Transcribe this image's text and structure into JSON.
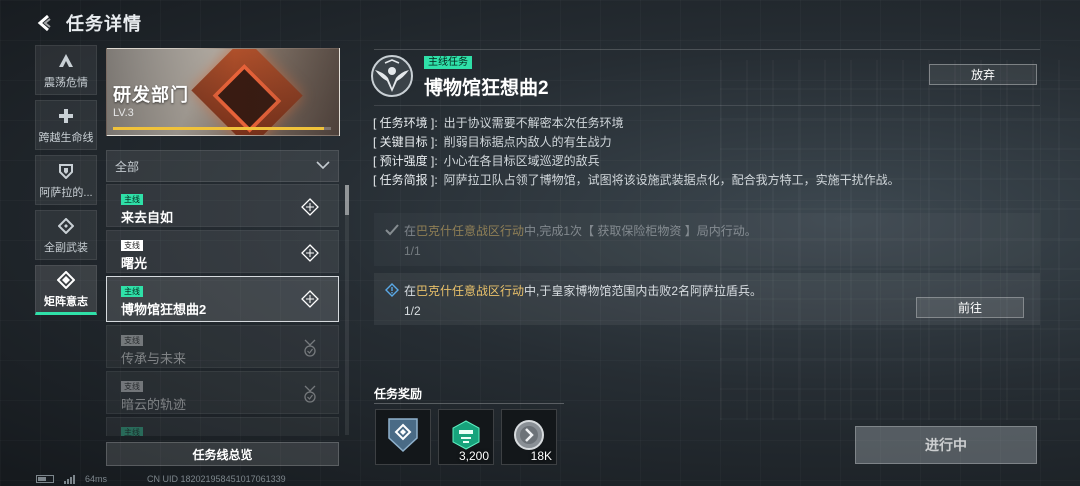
{
  "header": {
    "title": "任务详情"
  },
  "rail": [
    {
      "label": "震荡危情",
      "icon": "triangle-logo-icon"
    },
    {
      "label": "跨越生命线",
      "icon": "plus-icon"
    },
    {
      "label": "阿萨拉的...",
      "icon": "shield-icon"
    },
    {
      "label": "全副武装",
      "icon": "hex-diamond-icon"
    },
    {
      "label": "矩阵意志",
      "icon": "matrix-diamond-icon",
      "active": true
    }
  ],
  "banner": {
    "title": "研发部门",
    "level": "LV.3",
    "progress": 0.97,
    "bar_color": "#f0c23a"
  },
  "filter": {
    "selected": "全部"
  },
  "quests": [
    {
      "tag": "主线",
      "name": "来去自如",
      "tag_type": "main",
      "state": "active"
    },
    {
      "tag": "支线",
      "name": "曙光",
      "tag_type": "side",
      "state": "active"
    },
    {
      "tag": "主线",
      "name": "博物馆狂想曲2",
      "tag_type": "main",
      "state": "selected"
    },
    {
      "tag": "支线",
      "name": "传承与未来",
      "tag_type": "side",
      "state": "done"
    },
    {
      "tag": "支线",
      "name": "暗云的轨迹",
      "tag_type": "side",
      "state": "done"
    },
    {
      "tag": "主线",
      "name": "",
      "tag_type": "main",
      "state": "done"
    }
  ],
  "overview_button": "任务线总览",
  "status": {
    "ping": "64ms",
    "uid": "CN UID 182021958451017061339"
  },
  "detail": {
    "tag": "主线任务",
    "title": "博物馆狂想曲2",
    "abandon": "放弃",
    "info": [
      {
        "key": "[ 任务环境 ]:",
        "value": "出于协议需要不解密本次任务环境"
      },
      {
        "key": "[ 关键目标 ]:",
        "value": "削弱目标据点内敌人的有生战力"
      },
      {
        "key": "[ 预计强度 ]:",
        "value": "小心在各目标区域巡逻的敌兵"
      },
      {
        "key": "[ 任务简报 ]:",
        "value": "阿萨拉卫队占领了博物馆，试图将该设施武装据点化，配合我方特工，实施干扰作战。"
      }
    ],
    "objectives": [
      {
        "pre": "在",
        "place": "巴克什任意战区行动",
        "post": "中,完成1次【 获取保险柜物资 】局内行动。",
        "progress": "1/1",
        "done": true
      },
      {
        "pre": "在",
        "place": "巴克什任意战区行动",
        "post": "中,于皇家博物馆范围内击败2名阿萨拉盾兵。",
        "progress": "1/2",
        "done": false,
        "button": "前往"
      }
    ],
    "rewards_label": "任务奖励",
    "rewards": [
      {
        "icon": "matrix-shield-icon",
        "qty": ""
      },
      {
        "icon": "green-emblem-icon",
        "qty": "3,200"
      },
      {
        "icon": "silver-coin-icon",
        "qty": "18K"
      }
    ],
    "status_button": "进行中"
  },
  "colors": {
    "accent": "#2fe0a8",
    "highlight": "#e9c16a"
  }
}
